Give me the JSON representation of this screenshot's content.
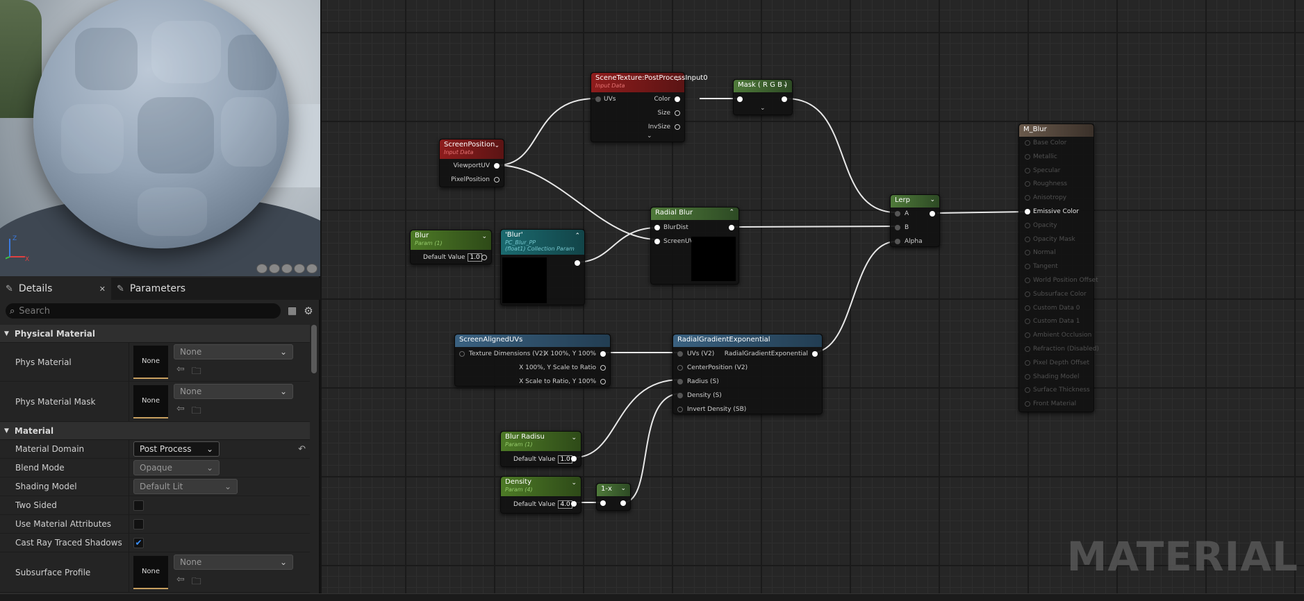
{
  "left_panel": {
    "viewport_buttons": [
      "cylinder-icon",
      "sphere-icon",
      "plane-icon",
      "cube-icon",
      "teapot-icon"
    ],
    "tabs": [
      {
        "label": "Details",
        "icon": "pencil-icon",
        "close": "✕"
      },
      {
        "label": "Parameters",
        "icon": "pencil-icon"
      }
    ],
    "search": {
      "placeholder": "Search"
    },
    "categories": {
      "physical_material": {
        "title": "Physical Material",
        "rows": [
          {
            "label": "Phys Material",
            "thumb": "None",
            "combo": "None"
          },
          {
            "label": "Phys Material Mask",
            "thumb": "None",
            "combo": "None"
          }
        ]
      },
      "material": {
        "title": "Material",
        "rows": {
          "domain": {
            "label": "Material Domain",
            "value": "Post Process"
          },
          "blend": {
            "label": "Blend Mode",
            "value": "Opaque"
          },
          "shading": {
            "label": "Shading Model",
            "value": "Default Lit"
          },
          "two_sided": {
            "label": "Two Sided",
            "checked": false
          },
          "use_attr": {
            "label": "Use Material Attributes",
            "checked": false
          },
          "ray_shadows": {
            "label": "Cast Ray Traced Shadows",
            "checked": true
          },
          "subsurface": {
            "label": "Subsurface Profile",
            "thumb": "None",
            "combo": "None"
          }
        }
      }
    }
  },
  "graph": {
    "watermark": "MATERIAL",
    "nodes": {
      "scene_texture": {
        "title": "SceneTexture:PostProcessInput0",
        "subtitle": "Input Data",
        "inputs": [
          "UVs"
        ],
        "outputs": [
          "Color",
          "Size",
          "InvSize"
        ]
      },
      "mask": {
        "title": "Mask ( R G B )"
      },
      "screen_position": {
        "title": "ScreenPosition",
        "subtitle": "Input Data",
        "outputs": [
          "ViewportUV",
          "PixelPosition"
        ]
      },
      "blur": {
        "title": "Blur",
        "subtitle": "Param (1)",
        "default_label": "Default Value",
        "default_value": "1.0"
      },
      "blur_collection": {
        "title": "'Blur'",
        "subtitle": "PC_Blur_PP",
        "subtitle2": "(float1) Collection Param"
      },
      "radial_blur": {
        "title": "Radial Blur",
        "inputs": [
          "BlurDist",
          "ScreenUV"
        ]
      },
      "lerp": {
        "title": "Lerp",
        "inputs": [
          "A",
          "B",
          "Alpha"
        ]
      },
      "m_blur": {
        "title": "M_Blur",
        "pins": [
          "Base Color",
          "Metallic",
          "Specular",
          "Roughness",
          "Anisotropy",
          "Emissive Color",
          "Opacity",
          "Opacity Mask",
          "Normal",
          "Tangent",
          "World Position Offset",
          "Subsurface Color",
          "Custom Data 0",
          "Custom Data 1",
          "Ambient Occlusion",
          "Refraction (Disabled)",
          "Pixel Depth Offset",
          "Shading Model",
          "Surface Thickness",
          "Front Material"
        ]
      },
      "screen_aligned": {
        "title": "ScreenAlignedUVs",
        "input": "Texture Dimensions (V2)",
        "outputs": [
          "X 100%, Y 100%",
          "X 100%, Y Scale to Ratio",
          "X Scale to Ratio, Y 100%"
        ]
      },
      "radial_gradient": {
        "title": "RadialGradientExponential",
        "inputs": [
          "UVs (V2)",
          "CenterPosition (V2)",
          "Radius (S)",
          "Density (S)",
          "Invert Density (SB)"
        ],
        "output": "RadialGradientExponential"
      },
      "blur_radius": {
        "title": "Blur Radisu",
        "subtitle": "Param (1)",
        "default_label": "Default Value",
        "default_value": "1.0"
      },
      "density": {
        "title": "Density",
        "subtitle": "Param (4)",
        "default_label": "Default Value",
        "default_value": "4.0"
      },
      "one_minus": {
        "title": "1-x"
      }
    }
  },
  "colors": {
    "input_data_header": "#8e1c1c",
    "param_header": "#4d7a26",
    "collection_header": "#1b6a6f",
    "function_header": "#3a6180",
    "result_header": "#6a5a4c",
    "thumb_accent": "#c8a060"
  }
}
